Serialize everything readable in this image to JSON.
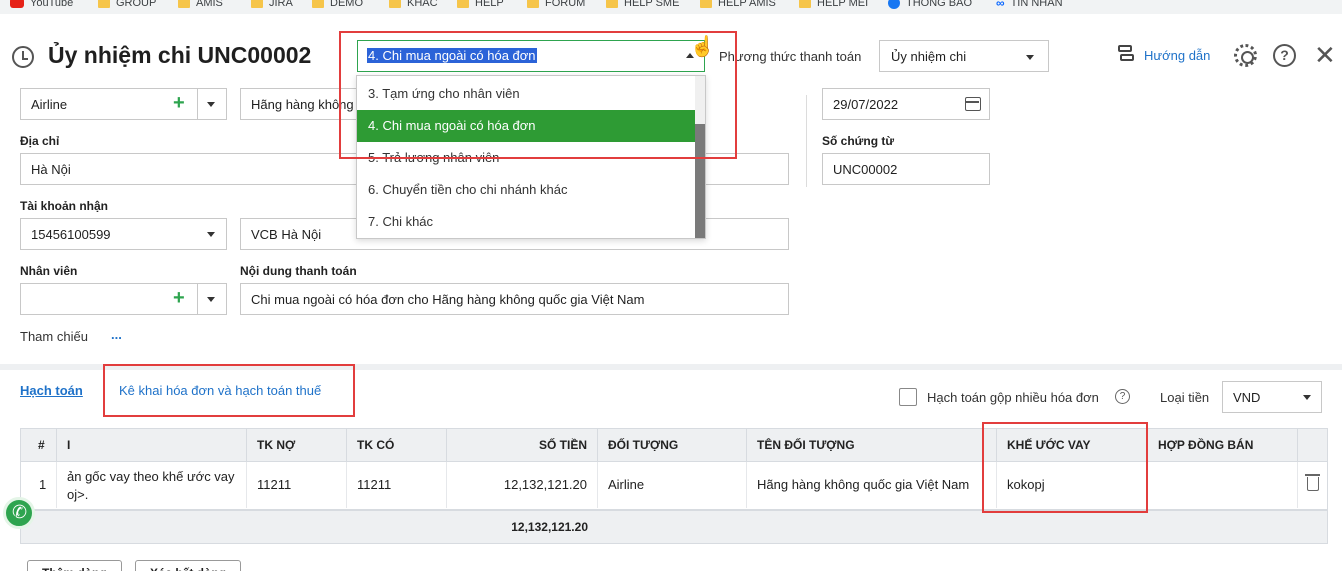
{
  "bookmarks": [
    "YouTube",
    "GROUP",
    "AMIS",
    "JIRA",
    "DEMO",
    "KHÁC",
    "HELP",
    "FORUM",
    "HELP SME",
    "HELP AMIS",
    "HELP MEI",
    "THÔNG BÁO",
    "TIN NHẮN"
  ],
  "header": {
    "title": "Ủy nhiệm chi UNC00002",
    "reason_value": "4. Chi mua ngoài có hóa đơn",
    "payment_method_label": "Phương thức thanh toán",
    "payment_method_value": "Ủy nhiệm chi",
    "guide_label": "Hướng dẫn",
    "help_glyph": "?",
    "close_glyph": "✕"
  },
  "reason_options": [
    "3. Tạm ứng cho nhân viên",
    "4. Chi mua ngoài có hóa đơn",
    "5. Trả lương nhân viên",
    "6. Chuyển tiền cho chi nhánh khác",
    "7. Chi khác"
  ],
  "reason_selected_index": 1,
  "form": {
    "object_code": "Airline",
    "object_name": "Hãng hàng không quốc gia Việt Nam",
    "address_label": "Địa chỉ",
    "address": "Hà Nội",
    "receive_account_label": "Tài khoản nhận",
    "receive_account": "15456100599",
    "bank_name": "VCB Hà Nội",
    "employee_label": "Nhân viên",
    "employee": "",
    "content_label": "Nội dung thanh toán",
    "content": "Chi mua ngoài có hóa đơn cho Hãng hàng không quốc gia Việt Nam",
    "reference_label": "Tham chiếu",
    "reference_more": "...",
    "date": "29/07/2022",
    "voucher_no_label": "Số chứng từ",
    "voucher_no": "UNC00002"
  },
  "tabs": {
    "accounting": "Hạch toán",
    "invoice_tax": "Kê khai hóa đơn và hạch toán thuế"
  },
  "options": {
    "merge_invoices_label": "Hạch toán gộp nhiều hóa đơn",
    "currency_label": "Loại tiền",
    "currency_value": "VND"
  },
  "table": {
    "headers": {
      "no": "#",
      "desc": "I",
      "debit": "TK NỢ",
      "credit": "TK CÓ",
      "amount": "SỐ TIỀN",
      "object": "ĐỐI TƯỢNG",
      "object_name": "TÊN ĐỐI TƯỢNG",
      "loan": "KHẾ ƯỚC VAY",
      "sale_contract": "HỢP ĐỒNG BÁN"
    },
    "row": {
      "no": "1",
      "desc_line1": "ản gốc vay theo khế ước vay",
      "desc_line2": "oj>.",
      "debit": "11211",
      "credit": "11211",
      "amount": "12,132,121.20",
      "object": "Airline",
      "object_name": "Hãng hàng không quốc gia Việt Nam",
      "loan": "kokopj",
      "sale_contract": ""
    },
    "total": "12,132,121.20"
  },
  "buttons": {
    "add_row": "Thêm dòng",
    "delete_all": "Xóa hết dòng"
  }
}
